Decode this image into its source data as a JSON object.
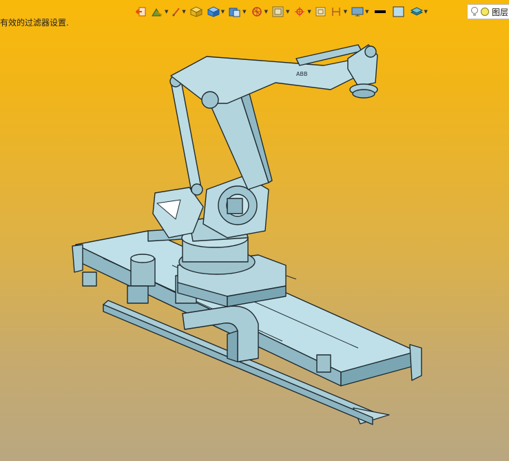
{
  "status": {
    "message": "有效的过滤器设置."
  },
  "toolbar": {
    "items": [
      {
        "icon": "exit-icon"
      },
      {
        "icon": "tree-brush-icon",
        "dropdown": true
      },
      {
        "icon": "pencil-icon",
        "dropdown": true
      },
      {
        "icon": "shaded-cube-icon"
      },
      {
        "icon": "blue-cube-icon",
        "dropdown": true
      },
      {
        "icon": "cube-view-icon",
        "dropdown": true
      },
      {
        "icon": "sphere-view-icon",
        "dropdown": true
      },
      {
        "icon": "image-frame-icon",
        "dropdown": true
      },
      {
        "icon": "target-point-icon",
        "dropdown": true
      },
      {
        "icon": "single-frame-icon"
      },
      {
        "icon": "split-frame-icon",
        "dropdown": true
      },
      {
        "icon": "monitor-icon",
        "dropdown": true
      },
      {
        "icon": "line-weight-icon"
      },
      {
        "icon": "fill-color-icon"
      },
      {
        "icon": "layers-stack-icon",
        "dropdown": true
      }
    ],
    "layer": {
      "label": "图层"
    }
  },
  "colors": {
    "model": "#a9cdd7",
    "outline": "#1e2a30",
    "accent": "#e8520c"
  }
}
